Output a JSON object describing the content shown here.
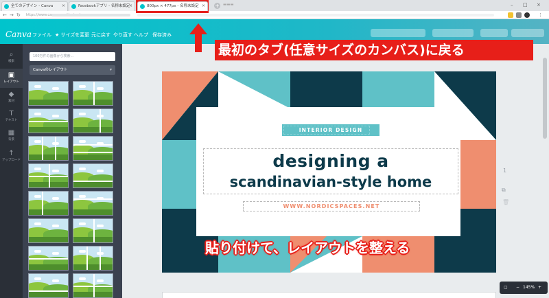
{
  "browser": {
    "tabs": [
      {
        "label": "全てのデザイン - Canva"
      },
      {
        "label": "Facebookアプリ - 名称未設定"
      },
      {
        "label": "800px × 477px - 名称未設定"
      }
    ],
    "url": "https://www.canva.com/design/..."
  },
  "toolbar": {
    "logo": "Canva",
    "menu": [
      "ファイル",
      "★ サイズを変更",
      "元に戻す",
      "やり直す",
      "ヘルプ",
      "保存済み"
    ]
  },
  "sidebar": {
    "items": [
      {
        "label": "検索",
        "icon": "search-icon"
      },
      {
        "label": "レイアウト",
        "icon": "layout-icon"
      },
      {
        "label": "素材",
        "icon": "shapes-icon"
      },
      {
        "label": "テキスト",
        "icon": "text-icon"
      },
      {
        "label": "背景",
        "icon": "background-icon"
      },
      {
        "label": "アップロード",
        "icon": "upload-icon"
      }
    ]
  },
  "panel": {
    "search_placeholder": "100万件の画像から検索...",
    "dropdown_label": "Canvaのレイアウト"
  },
  "design": {
    "tag": "INTERIOR DESIGN",
    "headline1": "designing a",
    "headline2": "scandinavian-style home",
    "url": "WWW.NORDICSPACES.NET",
    "colors": {
      "navy": "#0d3a4a",
      "teal": "#5fc1c7",
      "coral": "#ef8e6f",
      "white": "#ffffff"
    }
  },
  "workspace": {
    "page_number": "1",
    "zoom": "145%"
  },
  "annotations": {
    "top": "最初のタブ(任意サイズのカンバス)に戻る",
    "bottom": "貼り付けて、レイアウトを整える"
  }
}
